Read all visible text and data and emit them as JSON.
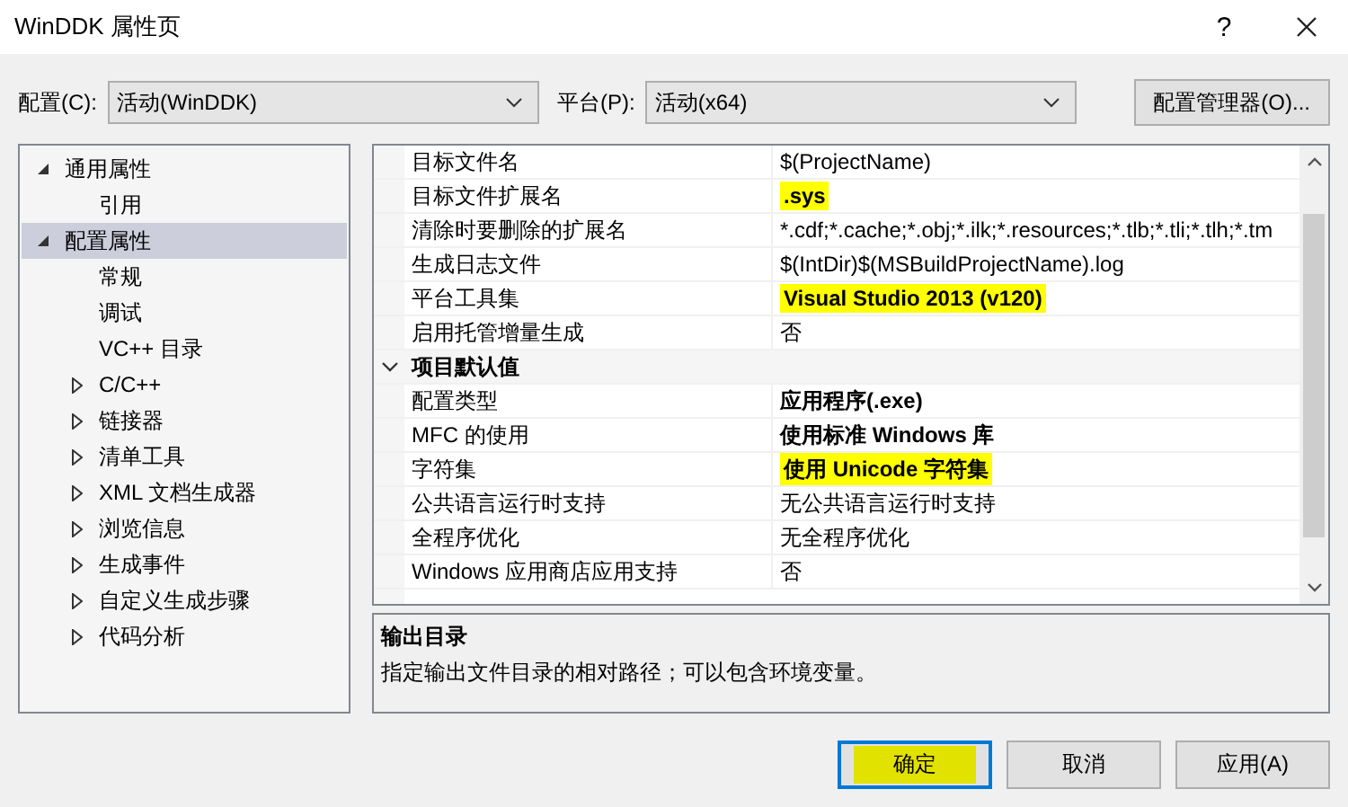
{
  "window": {
    "title": "WinDDK 属性页",
    "help": "?"
  },
  "toolbar": {
    "configuration": {
      "label": "配置(C):",
      "value": "活动(WinDDK)"
    },
    "platform": {
      "label": "平台(P):",
      "value": "活动(x64)"
    },
    "manager_button": "配置管理器(O)..."
  },
  "tree": [
    {
      "kind": "group",
      "label": "通用属性",
      "expanded": true,
      "selected": false,
      "children": [
        {
          "kind": "leaf",
          "label": "引用",
          "selected": false
        }
      ]
    },
    {
      "kind": "group",
      "label": "配置属性",
      "expanded": true,
      "selected": true,
      "children": [
        {
          "kind": "leaf",
          "label": "常规",
          "selected": false
        },
        {
          "kind": "leaf",
          "label": "调试",
          "selected": false
        },
        {
          "kind": "leaf",
          "label": "VC++ 目录",
          "selected": false
        },
        {
          "kind": "group",
          "label": "C/C++",
          "expanded": false,
          "selected": false
        },
        {
          "kind": "group",
          "label": "链接器",
          "expanded": false,
          "selected": false
        },
        {
          "kind": "group",
          "label": "清单工具",
          "expanded": false,
          "selected": false
        },
        {
          "kind": "group",
          "label": "XML 文档生成器",
          "expanded": false,
          "selected": false
        },
        {
          "kind": "group",
          "label": "浏览信息",
          "expanded": false,
          "selected": false
        },
        {
          "kind": "group",
          "label": "生成事件",
          "expanded": false,
          "selected": false
        },
        {
          "kind": "group",
          "label": "自定义生成步骤",
          "expanded": false,
          "selected": false
        },
        {
          "kind": "group",
          "label": "代码分析",
          "expanded": false,
          "selected": false
        }
      ]
    }
  ],
  "grid": {
    "rows": [
      {
        "kind": "property",
        "name": "目标文件名",
        "value": "$(ProjectName)",
        "bold": false,
        "highlighted": false
      },
      {
        "kind": "property",
        "name": "目标文件扩展名",
        "value": ".sys",
        "bold": true,
        "highlighted": true
      },
      {
        "kind": "property",
        "name": "清除时要删除的扩展名",
        "value": "*.cdf;*.cache;*.obj;*.ilk;*.resources;*.tlb;*.tli;*.tlh;*.tm",
        "bold": false,
        "highlighted": false
      },
      {
        "kind": "property",
        "name": "生成日志文件",
        "value": "$(IntDir)$(MSBuildProjectName).log",
        "bold": false,
        "highlighted": false
      },
      {
        "kind": "property",
        "name": "平台工具集",
        "value": "Visual Studio 2013 (v120)",
        "bold": true,
        "highlighted": true
      },
      {
        "kind": "property",
        "name": "启用托管增量生成",
        "value": "否",
        "bold": false,
        "highlighted": false
      },
      {
        "kind": "category",
        "name": "项目默认值",
        "expanded": true
      },
      {
        "kind": "property",
        "name": "配置类型",
        "value": "应用程序(.exe)",
        "bold": true,
        "highlighted": false
      },
      {
        "kind": "property",
        "name": "MFC 的使用",
        "value": "使用标准 Windows 库",
        "bold": true,
        "highlighted": false
      },
      {
        "kind": "property",
        "name": "字符集",
        "value": "使用 Unicode 字符集",
        "bold": true,
        "highlighted": true
      },
      {
        "kind": "property",
        "name": "公共语言运行时支持",
        "value": "无公共语言运行时支持",
        "bold": false,
        "highlighted": false
      },
      {
        "kind": "property",
        "name": "全程序优化",
        "value": "无全程序优化",
        "bold": false,
        "highlighted": false
      },
      {
        "kind": "property",
        "name": "Windows 应用商店应用支持",
        "value": "否",
        "bold": false,
        "highlighted": false
      }
    ]
  },
  "description": {
    "title": "输出目录",
    "text": "指定输出文件目录的相对路径；可以包含环境变量。"
  },
  "buttons": [
    {
      "label": "确定",
      "default": true,
      "highlighted": true
    },
    {
      "label": "取消",
      "default": false,
      "highlighted": false
    },
    {
      "label": "应用(A)",
      "default": false,
      "highlighted": false
    }
  ]
}
